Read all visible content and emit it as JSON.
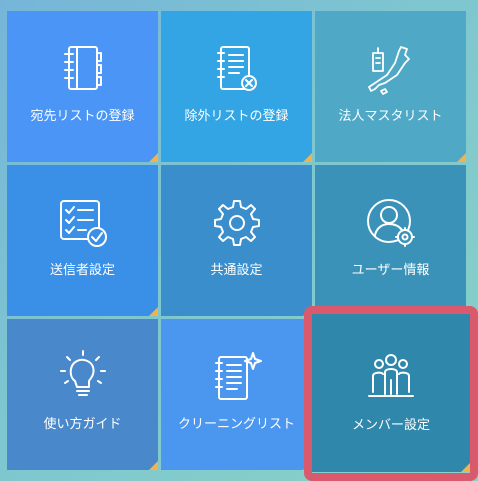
{
  "tiles": [
    {
      "label": "宛先リストの登録",
      "icon": "address-book-icon"
    },
    {
      "label": "除外リストの登録",
      "icon": "exclude-list-icon"
    },
    {
      "label": "法人マスタリスト",
      "icon": "japan-map-building-icon"
    },
    {
      "label": "送信者設定",
      "icon": "checklist-icon"
    },
    {
      "label": "共通設定",
      "icon": "gear-icon"
    },
    {
      "label": "ユーザー情報",
      "icon": "user-settings-icon"
    },
    {
      "label": "使い方ガイド",
      "icon": "lightbulb-icon"
    },
    {
      "label": "クリーニングリスト",
      "icon": "sparkle-list-icon"
    },
    {
      "label": "メンバー設定",
      "icon": "members-icon"
    }
  ],
  "colors": {
    "accent_corner": "#f3b24a",
    "highlight_border": "#d85a6c"
  },
  "highlighted_tile": "メンバー設定"
}
